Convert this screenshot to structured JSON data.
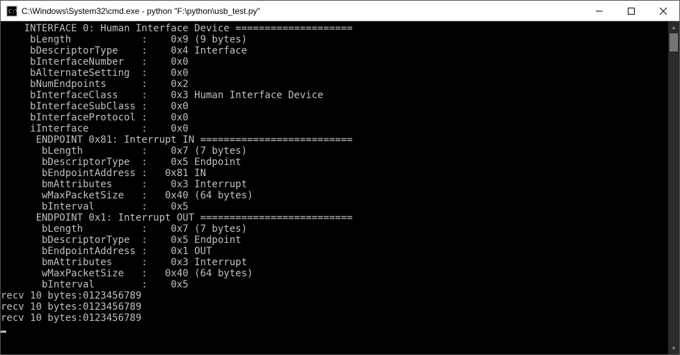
{
  "window": {
    "title": "C:\\Windows\\System32\\cmd.exe - python  \"F:\\python\\usb_test.py\""
  },
  "buttons": {
    "minimize": "—",
    "maximize": "□",
    "close": "✕"
  },
  "terminal": {
    "lines": [
      "    INTERFACE 0: Human Interface Device ====================",
      "     bLength            :    0x9 (9 bytes)",
      "     bDescriptorType    :    0x4 Interface",
      "     bInterfaceNumber   :    0x0",
      "     bAlternateSetting  :    0x0",
      "     bNumEndpoints      :    0x2",
      "     bInterfaceClass    :    0x3 Human Interface Device",
      "     bInterfaceSubClass :    0x0",
      "     bInterfaceProtocol :    0x0",
      "     iInterface         :    0x0",
      "      ENDPOINT 0x81: Interrupt IN ==========================",
      "       bLength          :    0x7 (7 bytes)",
      "       bDescriptorType  :    0x5 Endpoint",
      "       bEndpointAddress :   0x81 IN",
      "       bmAttributes     :    0x3 Interrupt",
      "       wMaxPacketSize   :   0x40 (64 bytes)",
      "       bInterval        :    0x5",
      "      ENDPOINT 0x1: Interrupt OUT ==========================",
      "       bLength          :    0x7 (7 bytes)",
      "       bDescriptorType  :    0x5 Endpoint",
      "       bEndpointAddress :    0x1 OUT",
      "       bmAttributes     :    0x3 Interrupt",
      "       wMaxPacketSize   :   0x40 (64 bytes)",
      "       bInterval        :    0x5",
      "recv 10 bytes:0123456789",
      "recv 10 bytes:0123456789",
      "recv 10 bytes:0123456789"
    ]
  }
}
